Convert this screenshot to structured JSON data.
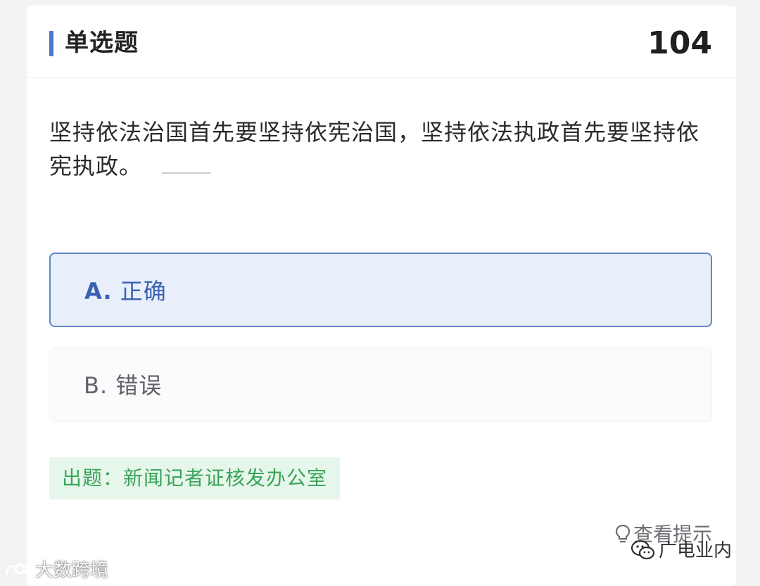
{
  "header": {
    "title": "单选题",
    "number": "104"
  },
  "question": {
    "text": "坚持依法治国首先要坚持依宪治国，坚持依法执政首先要坚持依宪执政。"
  },
  "options": [
    {
      "letter": "A.",
      "text": "正确",
      "selected": true
    },
    {
      "letter": "B.",
      "text": "错误",
      "selected": false
    }
  ],
  "source": {
    "label": "出题：新闻记者证核发办公室"
  },
  "hint": {
    "label": "查看提示"
  },
  "watermarks": {
    "left": "大数跨境",
    "right": "广电业内"
  },
  "colors": {
    "accent": "#4a78c9",
    "selected_bg": "#e9eefb",
    "selected_border": "#5f86cf",
    "source_bg": "#e6f6ea",
    "source_text": "#3aa45a"
  }
}
